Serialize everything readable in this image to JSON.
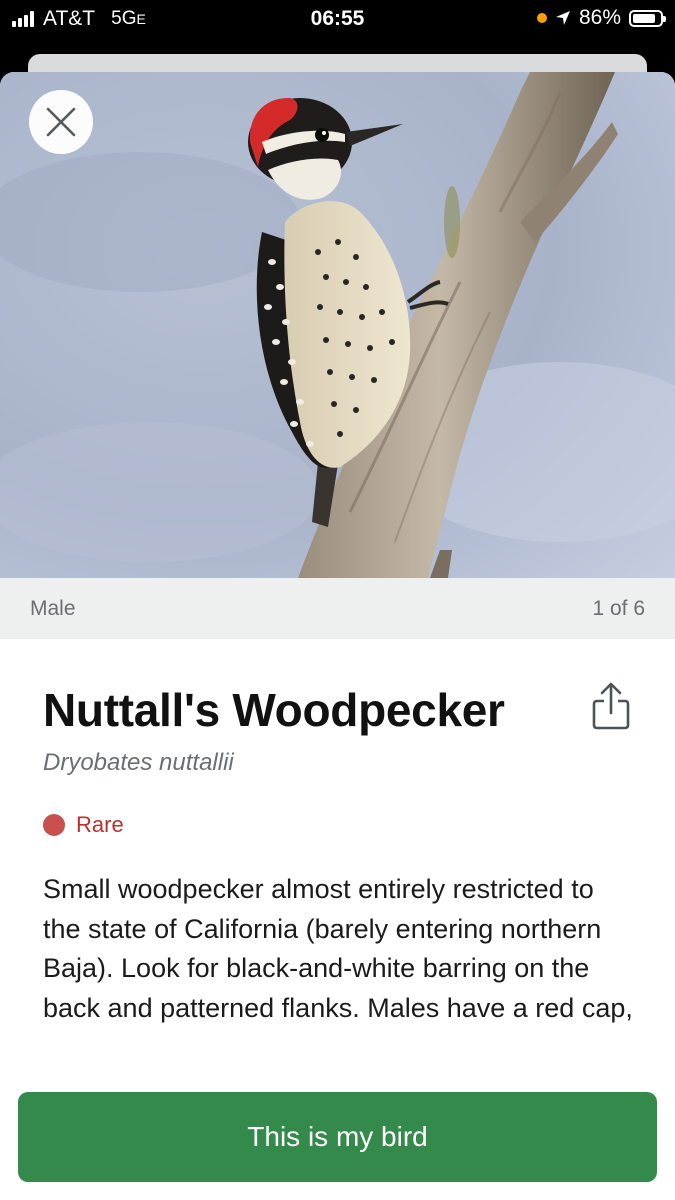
{
  "status_bar": {
    "carrier": "AT&T",
    "network": "5G",
    "network_suffix": "E",
    "time": "06:55",
    "battery": "86%",
    "battery_level": 0.86,
    "indicator_color": "#ff9f0a",
    "icons": [
      "signal-icon",
      "location-arrow-icon",
      "battery-icon"
    ]
  },
  "photo": {
    "subject": "woodpecker on branch",
    "caption_left": "Male",
    "caption_right": "1 of 6",
    "close_icon": "close-icon"
  },
  "species": {
    "common_name": "Nuttall's Woodpecker",
    "scientific_name": "Dryobates nuttallii",
    "rarity_label": "Rare",
    "rarity_color": "#c9504f",
    "share_icon": "share-icon",
    "description": "Small woodpecker almost entirely restricted to the state of California (barely entering northern Baja). Look for black-and-white barring on the back and patterned flanks. Males have a red cap,"
  },
  "actions": {
    "confirm_label": "This is my bird",
    "confirm_color": "#348a4a"
  }
}
